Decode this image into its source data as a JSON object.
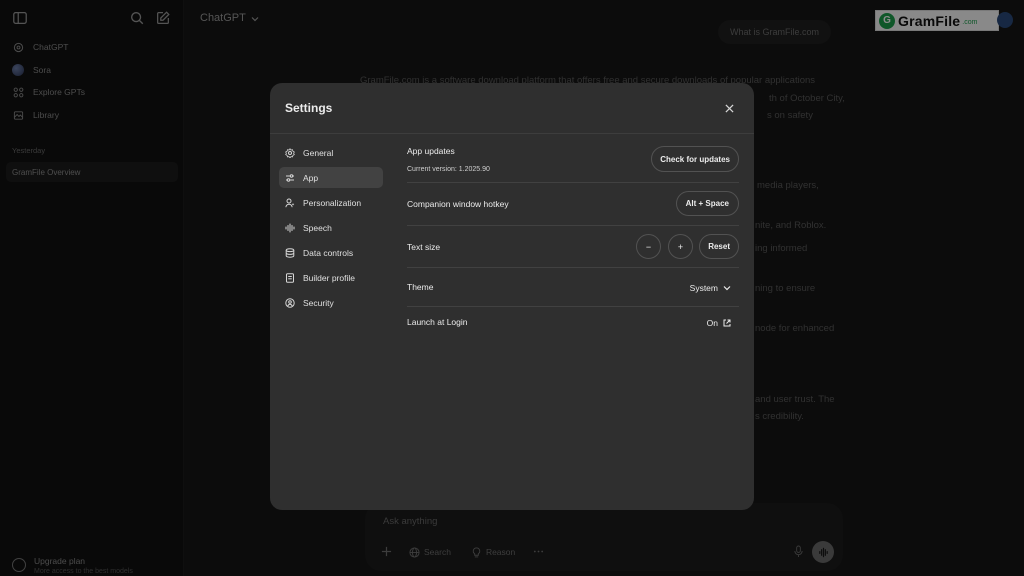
{
  "sidebar": {
    "items": [
      {
        "label": "ChatGPT",
        "icon": "openai-icon"
      },
      {
        "label": "Sora",
        "icon": "sora-icon"
      },
      {
        "label": "Explore GPTs",
        "icon": "grid-icon"
      },
      {
        "label": "Library",
        "icon": "library-icon"
      }
    ],
    "section_label": "Yesterday",
    "chat_title": "GramFile Overview",
    "upgrade_title": "Upgrade plan",
    "upgrade_subtitle": "More access to the best models"
  },
  "header": {
    "model": "ChatGPT",
    "watermark_text": "GramFile",
    "watermark_suffix": ".com"
  },
  "conversation": {
    "user_message": "What is GramFile.com",
    "visible_fragments": [
      "GramFile.com is a software download platform that offers free and secure downloads of popular applications",
      "th of October City,",
      "s on safety",
      "media players,",
      "nite, and Roblox.",
      "ing informed",
      "ning to ensure",
      "node for enhanced",
      "and user trust. The",
      "s credibility."
    ]
  },
  "composer": {
    "placeholder": "Ask anything",
    "search_label": "Search",
    "reason_label": "Reason"
  },
  "settings": {
    "title": "Settings",
    "nav": [
      {
        "label": "General",
        "icon": "gear-icon"
      },
      {
        "label": "App",
        "icon": "sliders-icon"
      },
      {
        "label": "Personalization",
        "icon": "personalization-icon"
      },
      {
        "label": "Speech",
        "icon": "waveform-icon"
      },
      {
        "label": "Data controls",
        "icon": "database-icon"
      },
      {
        "label": "Builder profile",
        "icon": "id-card-icon"
      },
      {
        "label": "Security",
        "icon": "shield-icon"
      }
    ],
    "active_nav": "App",
    "rows": {
      "app_updates": {
        "label": "App updates",
        "sub": "Current version: 1.2025.90",
        "button": "Check for updates"
      },
      "hotkey": {
        "label": "Companion window hotkey",
        "button": "Alt + Space"
      },
      "text_size": {
        "label": "Text size",
        "minus": "−",
        "plus": "+",
        "reset": "Reset"
      },
      "theme": {
        "label": "Theme",
        "value": "System"
      },
      "launch": {
        "label": "Launch at Login",
        "value": "On"
      }
    }
  },
  "colors": {
    "page_bg": "#161616",
    "sidebar_bg": "#121212",
    "modal_bg": "#2f2f2f",
    "active_nav_bg": "#424242",
    "text": "#ececec",
    "logo_green": "#1c9e4b"
  }
}
